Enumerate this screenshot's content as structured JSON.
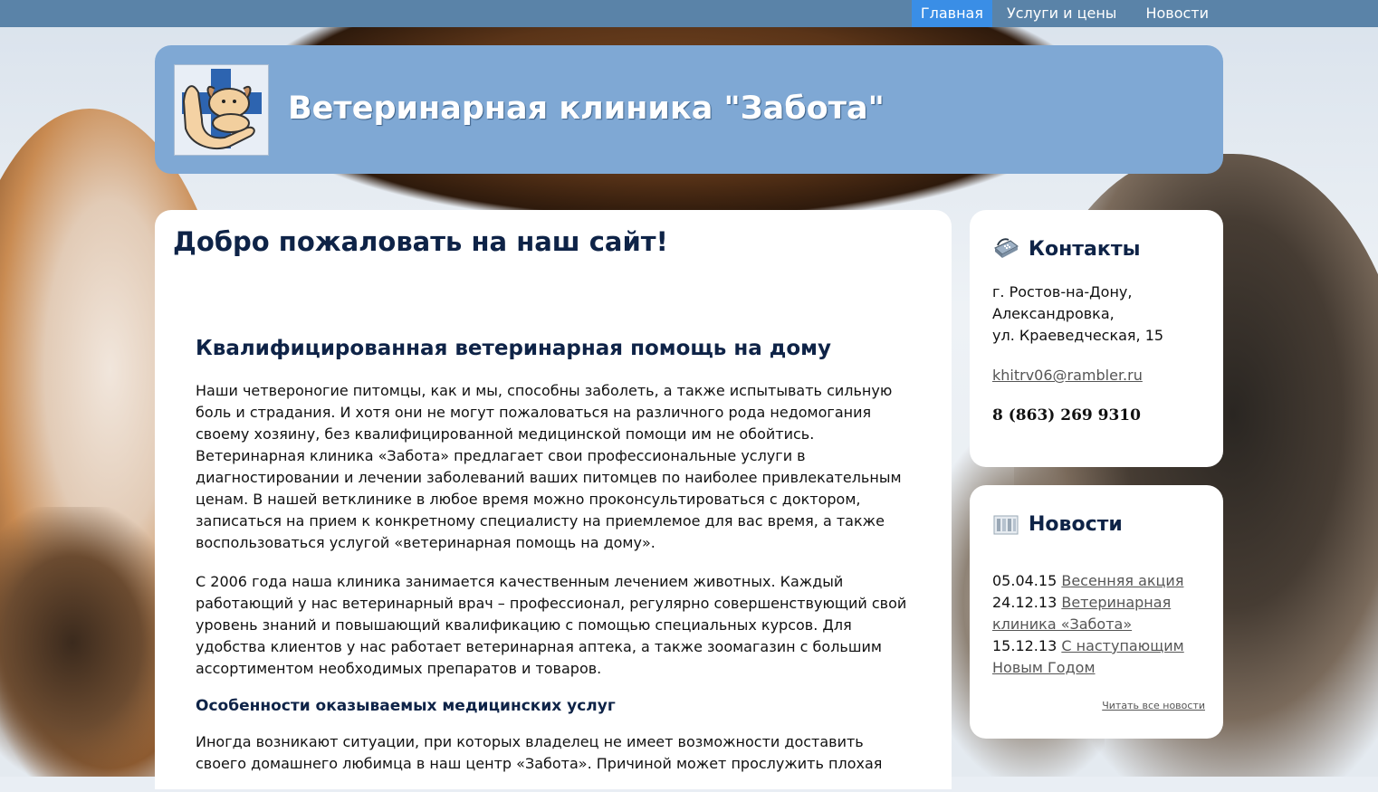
{
  "nav": {
    "items": [
      "Главная",
      "Услуги и цены",
      "Новости"
    ],
    "active": "Главная"
  },
  "header": {
    "title": "Ветеринарная клиника \"Забота\""
  },
  "main": {
    "heading": "Добро пожаловать на наш сайт!",
    "article": {
      "title": "Квалифицированная ветеринарная помощь на дому",
      "paragraph1": "Наши четвероногие питомцы, как и мы, способны заболеть, а также испытывать сильную боль и страдания. И хотя они не могут пожаловаться на различного рода недомогания своему хозяину, без квалифицированной медицинской помощи им не обойтись. Ветеринарная клиника «Забота» предлагает свои профессиональные услуги в диагностировании и лечении заболеваний ваших питомцев по наиболее привлекательным ценам. В нашей ветклинике в любое время можно проконсультироваться с доктором, записаться на прием к конкретному специалисту на приемлемое для вас время, а также воспользоваться услугой «ветеринарная помощь на дому».",
      "paragraph2": "С 2006 года наша клиника занимается качественным лечением животных. Каждый работающий у нас ветеринарный врач – профессионал, регулярно совершенствующий свой уровень знаний и повышающий квалификацию с помощью специальных курсов. Для удобства клиентов у нас работает ветеринарная аптека, а также зоомагазин с большим ассортиментом необходимых препаратов и товаров.",
      "subtitle": "Особенности оказываемых медицинских услуг",
      "paragraph3": "Иногда возникают ситуации, при которых владелец не имеет возможности доставить своего домашнего любимца в наш центр «Забота». Причиной может прослужить плохая"
    }
  },
  "contacts": {
    "title": "Контакты",
    "icon": "phone-icon",
    "address": [
      "г. Ростов-на-Дону,",
      "Александровка,",
      "ул. Краеведческая, 15"
    ],
    "email": "khitrv06@rambler.ru",
    "phone": "8 (863) 269 9310"
  },
  "news": {
    "title": "Новости",
    "icon": "newspaper-icon",
    "items": [
      {
        "date": "05.04.15",
        "title": "Весенняя акция"
      },
      {
        "date": "24.12.13",
        "title": "Ветеринарная клиника «Забота»"
      },
      {
        "date": "15.12.13",
        "title": "С наступающим Новым Годом"
      }
    ],
    "all_link": "Читать все новости"
  },
  "colors": {
    "nav_bg": "#5a83a8",
    "nav_active": "#3a8ee6",
    "header_bg": "#7fa8d4",
    "heading": "#0e2347"
  }
}
